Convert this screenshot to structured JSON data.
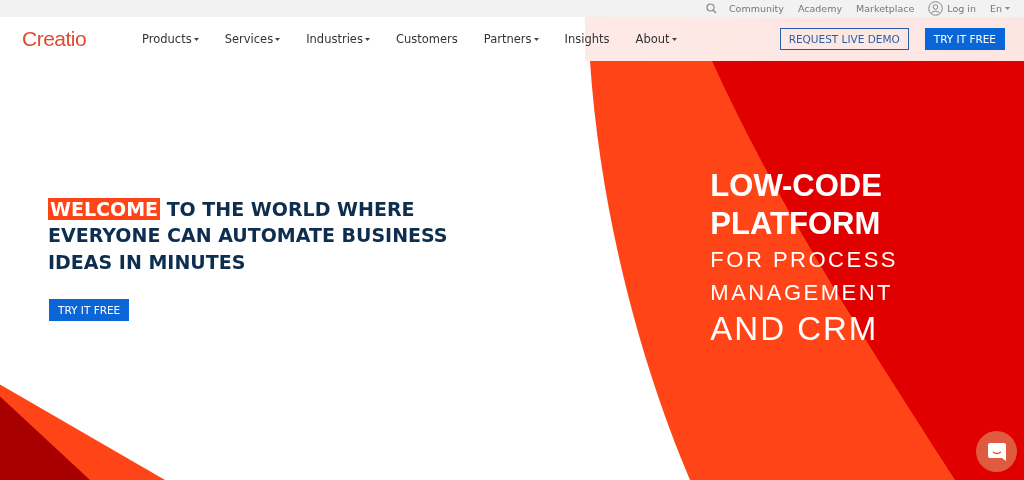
{
  "top_bar": {
    "links": [
      "Community",
      "Academy",
      "Marketplace"
    ],
    "login": "Log in",
    "language": "En"
  },
  "nav": {
    "logo": "Creatio",
    "items": [
      {
        "label": "Products",
        "dropdown": true
      },
      {
        "label": "Services",
        "dropdown": true
      },
      {
        "label": "Industries",
        "dropdown": true
      },
      {
        "label": "Customers",
        "dropdown": false
      },
      {
        "label": "Partners",
        "dropdown": true
      },
      {
        "label": "Insights",
        "dropdown": false
      },
      {
        "label": "About",
        "dropdown": true
      }
    ],
    "demo_button": "REQUEST LIVE DEMO",
    "try_button": "TRY IT FREE"
  },
  "hero": {
    "heading_highlight": "WELCOME",
    "heading_rest": "TO THE WORLD WHERE EVERYONE CAN AUTOMATE BUSINESS IDEAS IN MINUTES",
    "button": "TRY IT FREE",
    "tagline": [
      {
        "text": "LOW-CODE",
        "kind": "bold"
      },
      {
        "text": "PLATFORM",
        "kind": "bold"
      },
      {
        "text": "FOR PROCESS",
        "kind": "spaced"
      },
      {
        "text": "MANAGEMENT",
        "kind": "spaced"
      },
      {
        "text": "AND CRM",
        "kind": "light"
      }
    ]
  }
}
